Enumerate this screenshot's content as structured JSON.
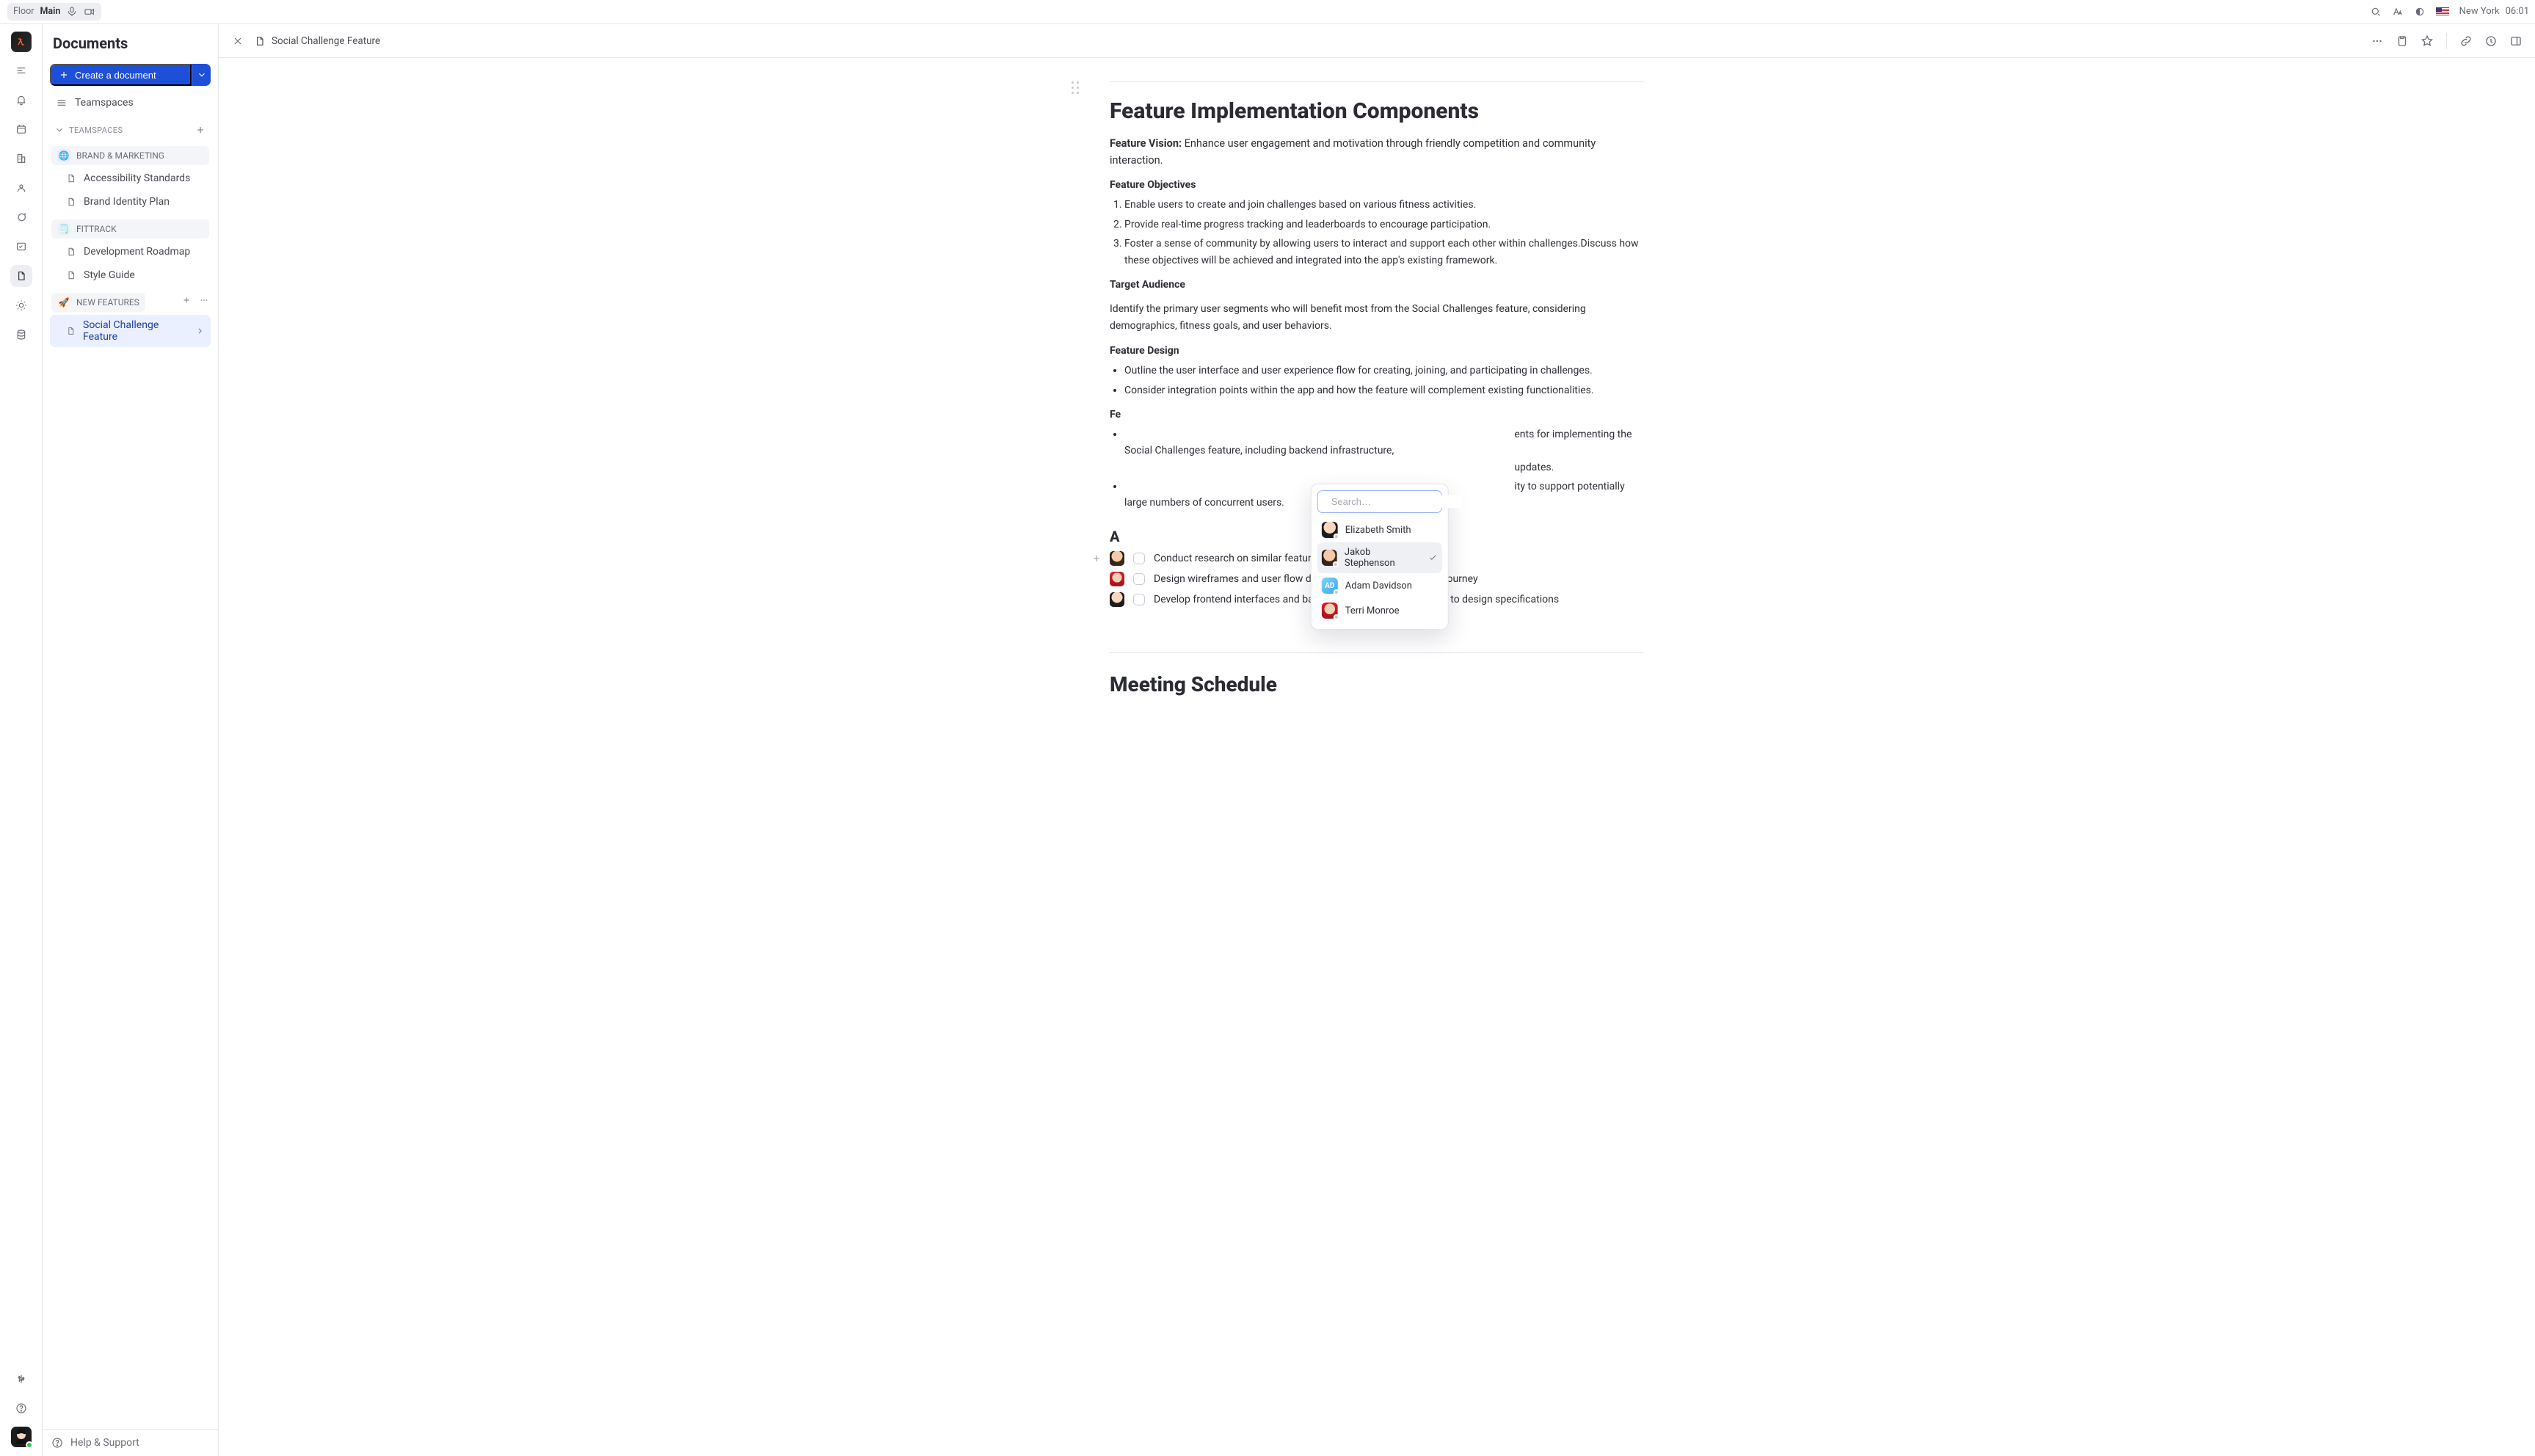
{
  "topbar": {
    "floor_label": "Floor",
    "floor_room": "Main",
    "city": "New York",
    "time": "06:01"
  },
  "colors": {
    "accent": "#1e4fd8",
    "border": "#e4e5ea",
    "text_muted": "#6b6d76"
  },
  "sidebar": {
    "title": "Documents",
    "create_label": "Create a document",
    "teamspaces_label": "Teamspaces",
    "sections": {
      "teamspaces_header": "TEAMSPACES"
    },
    "spaces": [
      {
        "id": "brand",
        "label": "BRAND & MARKETING",
        "emoji": "🌐",
        "variant": "purple",
        "items": [
          {
            "label": "Accessibility Standards"
          },
          {
            "label": "Brand Identity Plan"
          }
        ]
      },
      {
        "id": "fittrack",
        "label": "FITTRACK",
        "emoji": "🗒️",
        "variant": "teal",
        "items": [
          {
            "label": "Development Roadmap"
          },
          {
            "label": "Style Guide"
          }
        ]
      },
      {
        "id": "newfeat",
        "label": "NEW FEATURES",
        "emoji": "🚀",
        "variant": "amber",
        "items": [
          {
            "label": "Social Challenge Feature",
            "active": true
          }
        ]
      }
    ],
    "footer": {
      "help_label": "Help & Support"
    }
  },
  "doc": {
    "title": "Social Challenge Feature",
    "section_title": "Feature Implementation Components",
    "vision_label": "Feature Vision:",
    "vision_text": "Enhance user engagement and motivation through friendly competition and community interaction.",
    "objectives_label": "Feature Objectives",
    "objectives": [
      "Enable users to create and join challenges based on various fitness activities.",
      "Provide real-time progress tracking and leaderboards to encourage participation.",
      "Foster a sense of community by allowing users to interact and support each other within challenges.Discuss how these objectives will be achieved and integrated into the app's existing framework."
    ],
    "audience_label": "Target Audience",
    "audience_text": "Identify the primary user segments who will benefit most from the Social Challenges feature, considering demographics, fitness goals, and user behaviors.",
    "design_label": "Feature Design",
    "design_bullets": [
      "Outline the user interface and user experience flow for creating, joining, and participating in challenges.",
      "Consider integration points within the app and how the feature will complement existing functionalities."
    ],
    "feasibility_prefix": "Fe",
    "feasibility_bullets_partial": [
      "ents for implementing the Social Challenges feature, including backend infrastructure,",
      "updates.",
      "ity to support potentially large numbers of concurrent users."
    ],
    "action_title_prefix": "A",
    "tasks": [
      {
        "assignee": "js",
        "text": "Conduct research on similar features in competitor apps"
      },
      {
        "assignee": "tm",
        "text": "Design wireframes and user flow diagrams that outline the user journey"
      },
      {
        "assignee": "es",
        "text": "Develop frontend interfaces and backend functionality according to design specifications"
      }
    ],
    "meeting_title": "Meeting Schedule"
  },
  "mention": {
    "placeholder": "Search…",
    "people": [
      {
        "id": "es",
        "name": "Elizabeth Smith",
        "presence": "away"
      },
      {
        "id": "js",
        "name": "Jakob Stephenson",
        "presence": "away",
        "selected": true
      },
      {
        "id": "ad",
        "name": "Adam Davidson",
        "presence": "away",
        "initials": "AD"
      },
      {
        "id": "tm",
        "name": "Terri Monroe",
        "presence": "away"
      }
    ]
  },
  "icons": {
    "search": "search-icon",
    "text": "text-size-icon",
    "theme": "theme-icon",
    "flag_us": "flag-us",
    "close": "close-icon",
    "doc": "document-icon",
    "more": "more-icon",
    "tasks": "tasks-icon",
    "star": "star-icon",
    "link": "link-icon",
    "history": "history-icon",
    "panel": "panel-toggle-icon"
  }
}
